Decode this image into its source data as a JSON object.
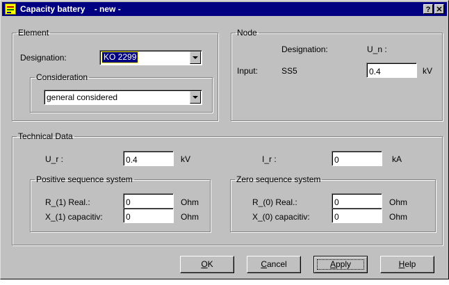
{
  "window": {
    "title": "Capacity battery    - new -",
    "help_glyph": "?",
    "close_glyph": "✕"
  },
  "element": {
    "legend": "Element",
    "designation_label": "Designation:",
    "designation_value": "KO   2299",
    "consideration": {
      "legend": "Consideration",
      "value": "general considered"
    }
  },
  "node": {
    "legend": "Node",
    "designation_header": "Designation:",
    "un_header": "U_n :",
    "input_label": "Input:",
    "input_designation": "SS5",
    "un_value": "0.4",
    "un_unit": "kV"
  },
  "technical": {
    "legend": "Technical Data",
    "ur_label": "U_r :",
    "ur_value": "0.4",
    "ur_unit": "kV",
    "ir_label": "I_r :",
    "ir_value": "0",
    "ir_unit": "kA",
    "positive": {
      "legend": "Positive sequence system",
      "r_label": "R_(1) Real.:",
      "r_value": "0",
      "r_unit": "Ohm",
      "x_label": "X_(1) capacitiv:",
      "x_value": "0",
      "x_unit": "Ohm"
    },
    "zero": {
      "legend": "Zero sequence system",
      "r_label": "R_(0) Real.:",
      "r_value": "0",
      "r_unit": "Ohm",
      "x_label": "X_(0) capacitiv:",
      "x_value": "0",
      "x_unit": "Ohm"
    }
  },
  "buttons": {
    "ok_prefix": "",
    "ok_key": "O",
    "ok_rest": "K",
    "cancel_key": "C",
    "cancel_rest": "ancel",
    "apply_key": "A",
    "apply_rest": "pply",
    "help_key": "H",
    "help_rest": "elp"
  },
  "colors": {
    "face": "#c0c0c0",
    "titlebar": "#000080",
    "selection": "#000080"
  }
}
